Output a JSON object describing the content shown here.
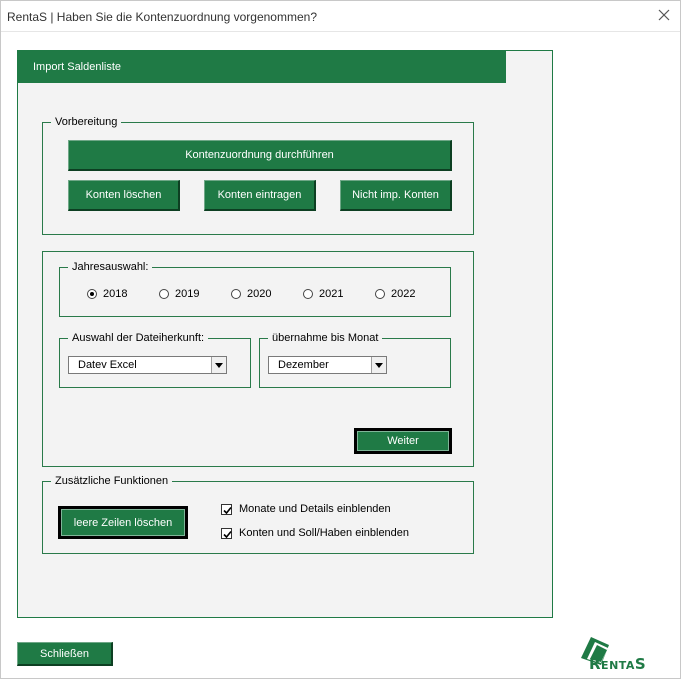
{
  "window": {
    "title": "RentaS | Haben Sie die Kontenzuordnung vorgenommen?"
  },
  "header": {
    "title": "Import Saldenliste"
  },
  "vorbereitung": {
    "legend": "Vorbereitung",
    "kontenzuordnung_label": "Kontenzuordnung durchführen",
    "konten_loeschen_label": "Konten löschen",
    "konten_eintragen_label": "Konten eintragen",
    "nicht_imp_label": "Nicht imp. Konten"
  },
  "jahresauswahl": {
    "legend": "Jahresauswahl:",
    "years": [
      "2018",
      "2019",
      "2020",
      "2021",
      "2022"
    ],
    "selected": "2018"
  },
  "dateiherkunft": {
    "legend": "Auswahl der Dateiherkunft:",
    "value": "Datev Excel"
  },
  "monat": {
    "legend": "übernahme bis Monat",
    "value": "Dezember"
  },
  "weiter_label": "Weiter",
  "zusatz": {
    "legend": "Zusätzliche Funktionen",
    "leere_zeilen_label": "leere Zeilen löschen",
    "monate_details_label": "Monate und Details einblenden",
    "monate_details_checked": true,
    "konten_soll_label": "Konten und Soll/Haben einblenden",
    "konten_soll_checked": true
  },
  "schliessen_label": "Schließen",
  "logo": {
    "text": "RentaS",
    "color": "#1f7a45"
  },
  "colors": {
    "accent": "#1f7a45",
    "panel": "#f3f3f3"
  }
}
